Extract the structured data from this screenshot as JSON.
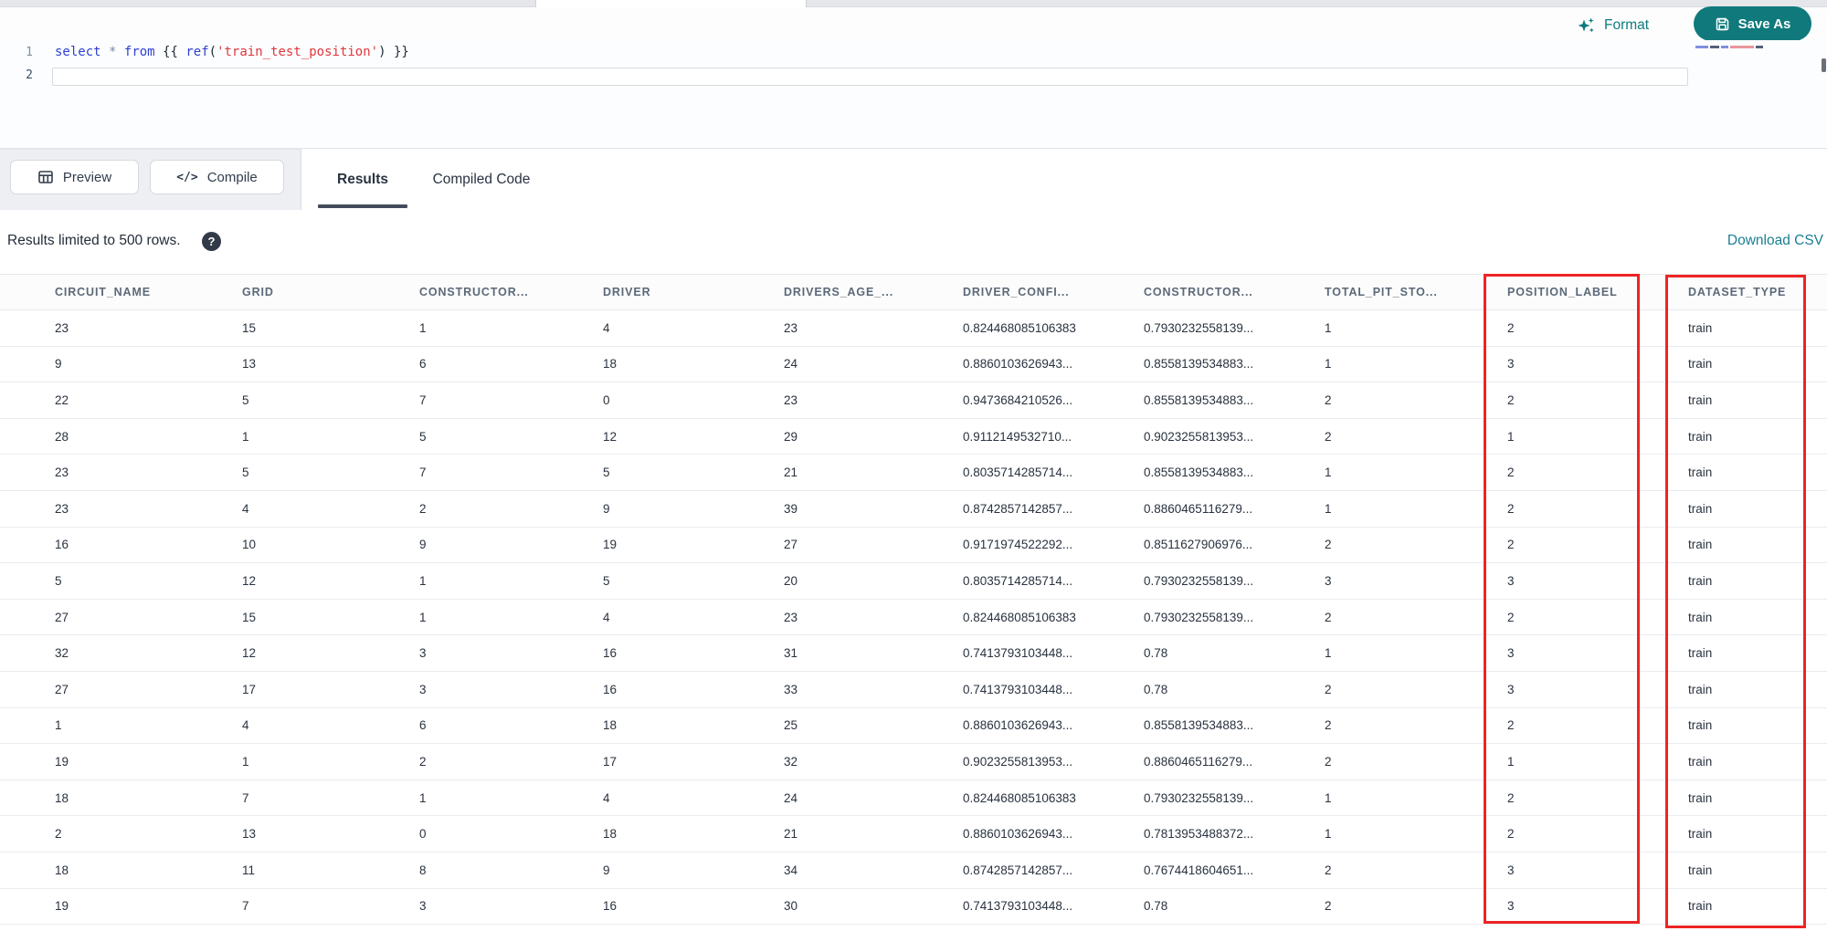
{
  "topbar": {
    "format_label": "Format",
    "save_as_label": "Save As"
  },
  "editor": {
    "line_numbers": [
      "1",
      "2"
    ],
    "content": "select * from {{ ref('train_test_position') }}",
    "code_tokens": [
      {
        "text": "select",
        "type": "keyword"
      },
      {
        "text": " ",
        "type": "plain"
      },
      {
        "text": "*",
        "type": "operator"
      },
      {
        "text": " ",
        "type": "plain"
      },
      {
        "text": "from",
        "type": "keyword"
      },
      {
        "text": " ",
        "type": "plain"
      },
      {
        "text": "{{",
        "type": "brace"
      },
      {
        "text": " ",
        "type": "plain"
      },
      {
        "text": "ref",
        "type": "function"
      },
      {
        "text": "(",
        "type": "brace"
      },
      {
        "text": "'train_test_position'",
        "type": "string"
      },
      {
        "text": ")",
        "type": "brace"
      },
      {
        "text": " ",
        "type": "plain"
      },
      {
        "text": "}}",
        "type": "brace"
      }
    ]
  },
  "toolbar": {
    "preview_label": "Preview",
    "compile_label": "Compile",
    "compile_icon_glyph": "</>",
    "tabs": [
      {
        "label": "Results",
        "active": true
      },
      {
        "label": "Compiled Code",
        "active": false
      }
    ]
  },
  "results_bar": {
    "limit_note": "Results limited to 500 rows.",
    "help_icon_glyph": "?",
    "download_csv_label": "Download CSV"
  },
  "table": {
    "columns": [
      "CIRCUIT_NAME",
      "GRID",
      "CONSTRUCTOR...",
      "DRIVER",
      "DRIVERS_AGE_...",
      "DRIVER_CONFI...",
      "CONSTRUCTOR...",
      "TOTAL_PIT_STO...",
      "POSITION_LABEL",
      "DATASET_TYPE"
    ],
    "rows": [
      [
        "23",
        "15",
        "1",
        "4",
        "23",
        "0.824468085106383",
        "0.7930232558139...",
        "1",
        "2",
        "train"
      ],
      [
        "9",
        "13",
        "6",
        "18",
        "24",
        "0.8860103626943...",
        "0.8558139534883...",
        "1",
        "3",
        "train"
      ],
      [
        "22",
        "5",
        "7",
        "0",
        "23",
        "0.9473684210526...",
        "0.8558139534883...",
        "2",
        "2",
        "train"
      ],
      [
        "28",
        "1",
        "5",
        "12",
        "29",
        "0.9112149532710...",
        "0.9023255813953...",
        "2",
        "1",
        "train"
      ],
      [
        "23",
        "5",
        "7",
        "5",
        "21",
        "0.8035714285714...",
        "0.8558139534883...",
        "1",
        "2",
        "train"
      ],
      [
        "23",
        "4",
        "2",
        "9",
        "39",
        "0.8742857142857...",
        "0.8860465116279...",
        "1",
        "2",
        "train"
      ],
      [
        "16",
        "10",
        "9",
        "19",
        "27",
        "0.9171974522292...",
        "0.8511627906976...",
        "2",
        "2",
        "train"
      ],
      [
        "5",
        "12",
        "1",
        "5",
        "20",
        "0.8035714285714...",
        "0.7930232558139...",
        "3",
        "3",
        "train"
      ],
      [
        "27",
        "15",
        "1",
        "4",
        "23",
        "0.824468085106383",
        "0.7930232558139...",
        "2",
        "2",
        "train"
      ],
      [
        "32",
        "12",
        "3",
        "16",
        "31",
        "0.7413793103448...",
        "0.78",
        "1",
        "3",
        "train"
      ],
      [
        "27",
        "17",
        "3",
        "16",
        "33",
        "0.7413793103448...",
        "0.78",
        "2",
        "3",
        "train"
      ],
      [
        "1",
        "4",
        "6",
        "18",
        "25",
        "0.8860103626943...",
        "0.8558139534883...",
        "2",
        "2",
        "train"
      ],
      [
        "19",
        "1",
        "2",
        "17",
        "32",
        "0.9023255813953...",
        "0.8860465116279...",
        "2",
        "1",
        "train"
      ],
      [
        "18",
        "7",
        "1",
        "4",
        "24",
        "0.824468085106383",
        "0.7930232558139...",
        "1",
        "2",
        "train"
      ],
      [
        "2",
        "13",
        "0",
        "18",
        "21",
        "0.8860103626943...",
        "0.7813953488372...",
        "1",
        "2",
        "train"
      ],
      [
        "18",
        "11",
        "8",
        "9",
        "34",
        "0.8742857142857...",
        "0.7674418604651...",
        "2",
        "3",
        "train"
      ],
      [
        "19",
        "7",
        "3",
        "16",
        "30",
        "0.7413793103448...",
        "0.78",
        "2",
        "3",
        "train"
      ]
    ]
  },
  "annotations": {
    "highlight_color": "#ee2424",
    "highlighted_columns": [
      "POSITION_LABEL",
      "DATASET_TYPE"
    ]
  },
  "colors": {
    "accent_teal": "#10797c",
    "link_teal": "#1b7f93",
    "annotation_red": "#ee2424"
  }
}
